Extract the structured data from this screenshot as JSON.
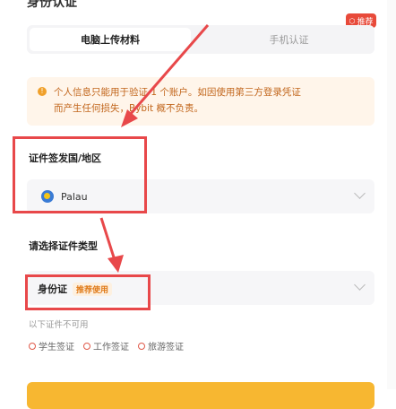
{
  "header": {
    "title": "身份认证"
  },
  "badge": {
    "label": "推荐",
    "icon": "hexagon-icon"
  },
  "tabs": [
    {
      "label": "电脑上传材料",
      "active": true
    },
    {
      "label": "手机认证",
      "active": false
    }
  ],
  "notice": {
    "line1": "个人信息只能用于验证 1 个账户。如因使用第三方登录凭证",
    "line2": "而产生任何损失，Bybit 概不负责。",
    "icon": "info-icon"
  },
  "country_section": {
    "label": "证件签发国/地区",
    "selected": "Palau",
    "flag_icon": "palau-flag-icon"
  },
  "document_section": {
    "label": "请选择证件类型",
    "selected": "身份证",
    "recommended_tag": "推荐使用"
  },
  "unavailable": {
    "label": "以下证件不可用",
    "items": [
      "学生签证",
      "工作签证",
      "旅游签证"
    ]
  },
  "colors": {
    "accent": "#f7b731",
    "annotation_red": "#e8484a",
    "notice_bg": "#fff5ea",
    "notice_text": "#c2661c"
  }
}
